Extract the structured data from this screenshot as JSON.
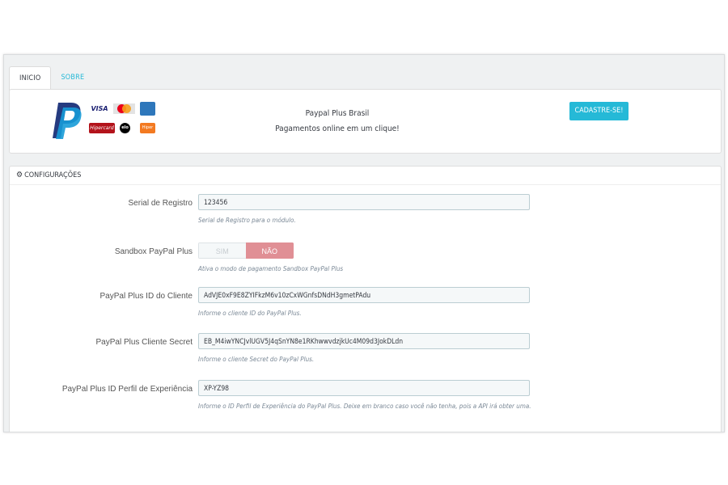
{
  "tabs": [
    {
      "label": "INICIO",
      "active": true
    },
    {
      "label": "SOBRE",
      "active": false
    }
  ],
  "header": {
    "title": "Paypal Plus Brasil",
    "subtitle": "Pagamentos online em um clique!",
    "cta_label": "CADASTRE-SE!",
    "payment_logos": {
      "visa": "VISA",
      "mastercard": "MasterCard",
      "amex": "AMEX",
      "hipercard": "Hipercard",
      "elo": "elo",
      "hiper": "Hiper"
    }
  },
  "config": {
    "title": "CONFIGURAÇÕES",
    "fields": [
      {
        "label": "Serial de Registro",
        "value": "123456",
        "help": "Serial de Registro para o módulo."
      },
      {
        "label": "Sandbox PayPal Plus",
        "on_label": "SIM",
        "off_label": "NÃO",
        "selected": "NÃO",
        "help": "Ativa o modo de pagamento Sandbox PayPal Plus"
      },
      {
        "label": "PayPal Plus ID do Cliente",
        "value": "AdVJE0xF9E8ZYIFkzM6v10zCxWGnfsDNdH3gmetPAdu",
        "help": "Informe o cliente ID do PayPal Plus."
      },
      {
        "label": "PayPal Plus Cliente Secret",
        "value": "EB_M4iwYNCJvlUGV5J4qSnYN8e1RKhwwvdzjkUc4M09d3JokDLdn",
        "help": "Informe o cliente Secret do PayPal Plus."
      },
      {
        "label": "PayPal Plus ID Perfil de Experiência",
        "value": "XP-YZ98",
        "help": "Informe o ID Perfil de Experiência do PayPal Plus. Deixe em branco caso você não tenha, pois a API irá obter uma."
      }
    ]
  },
  "colors": {
    "accent": "#25b9d7",
    "switch_off_active": "#e08f95",
    "paypal_dark": "#253b80",
    "paypal_light": "#179bd7"
  }
}
